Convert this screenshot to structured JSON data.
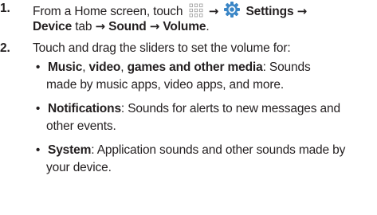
{
  "step1": {
    "number": "1.",
    "part1": "From a Home screen, touch",
    "apps_icon": "apps-grid-icon",
    "arrow": "→",
    "settings_icon": "gear-icon",
    "settings": "Settings",
    "device": "Device",
    "tab": "tab",
    "sound": "Sound",
    "volume": "Volume",
    "period": "."
  },
  "step2": {
    "number": "2.",
    "intro": "Touch and drag the sliders to set the volume for:",
    "bullets": [
      {
        "dot": "•",
        "term_a": "Music",
        "sep_a": ", ",
        "term_b": "video",
        "sep_b": ", ",
        "term_c": "games and other media",
        "desc_line1": ": Sounds",
        "desc_line2": "made by music apps, video apps, and more."
      },
      {
        "dot": "•",
        "term": "Notifications",
        "desc_line1": ": Sounds for alerts to new messages and",
        "desc_line2": "other events."
      },
      {
        "dot": "•",
        "term": "System",
        "desc_line1": ": Application sounds and other sounds made by",
        "desc_line2": "your device."
      }
    ]
  },
  "colors": {
    "text": "#231f20",
    "icon_blue": "#3b86c6"
  }
}
